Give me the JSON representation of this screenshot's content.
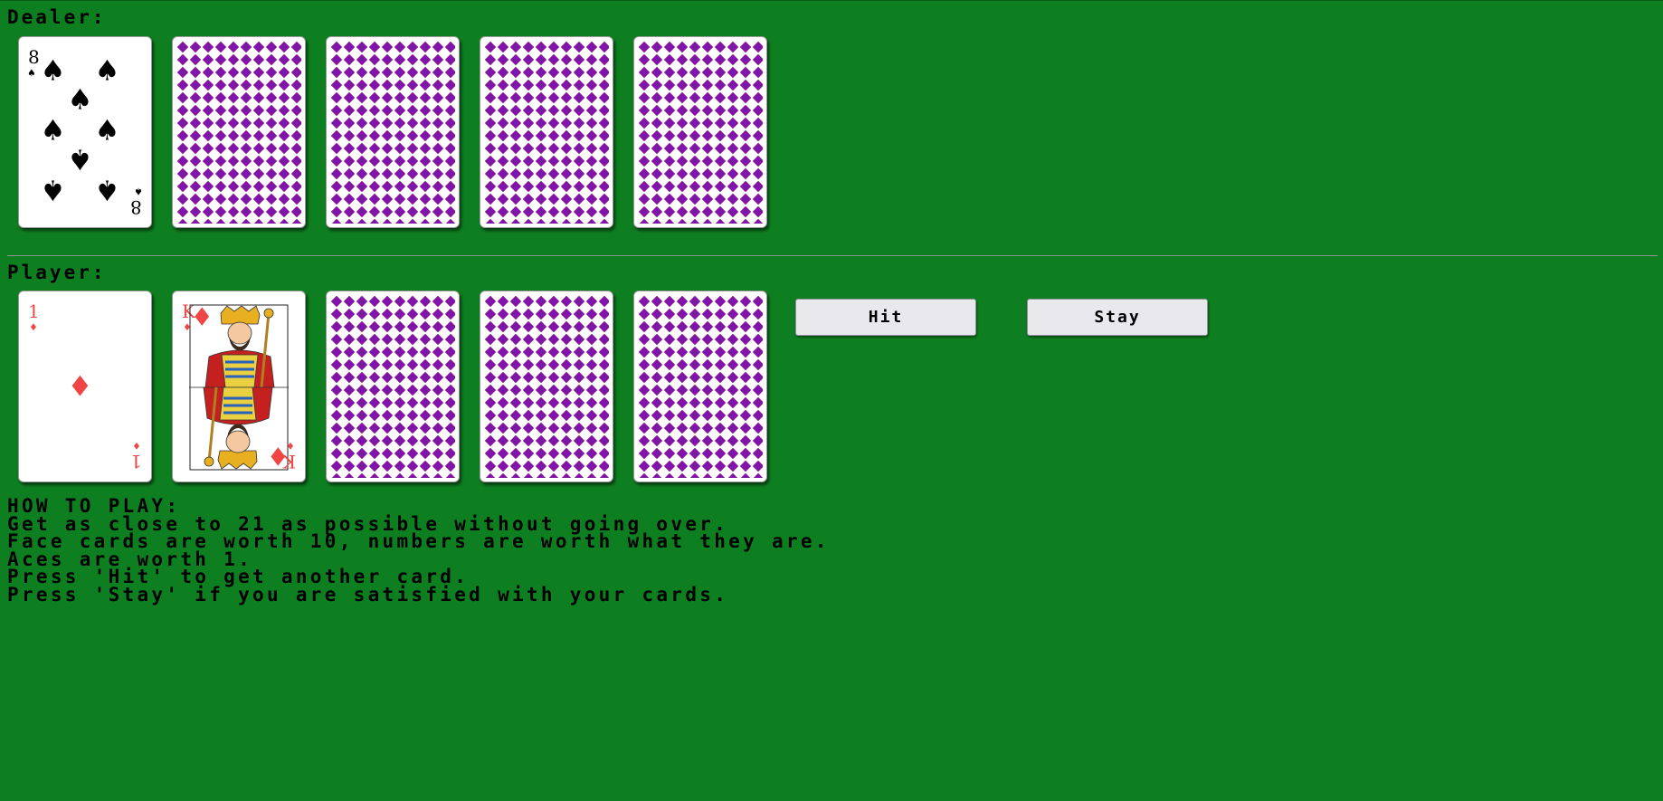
{
  "dealer": {
    "label": "Dealer:",
    "cards": [
      {
        "face": "up",
        "rank": "8",
        "suit": "spades"
      },
      {
        "face": "down"
      },
      {
        "face": "down"
      },
      {
        "face": "down"
      },
      {
        "face": "down"
      }
    ]
  },
  "player": {
    "label": "Player:",
    "cards": [
      {
        "face": "up",
        "rank": "1",
        "suit": "diamonds"
      },
      {
        "face": "up",
        "rank": "K",
        "suit": "diamonds"
      },
      {
        "face": "down"
      },
      {
        "face": "down"
      },
      {
        "face": "down"
      }
    ]
  },
  "controls": {
    "hit_label": "Hit",
    "stay_label": "Stay"
  },
  "instructions": {
    "title": "HOW TO PLAY:",
    "lines": [
      "Get as close to 21 as possible without going over.",
      "Face cards are worth 10, numbers are worth what they are.",
      "Aces are worth 1.",
      "Press 'Hit' to get another card.",
      "Press 'Stay' if you are satisfied with your cards."
    ]
  },
  "colors": {
    "table": "#0e7f20",
    "red_suit": "#f04545",
    "card_back": "#8a10a0"
  }
}
